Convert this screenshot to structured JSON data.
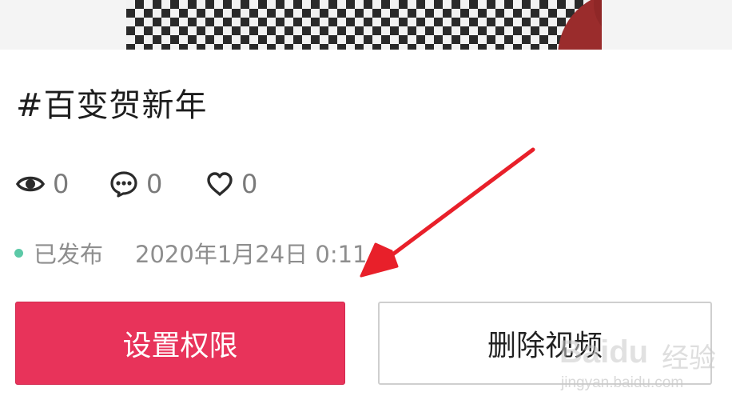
{
  "video": {
    "title": "#百变贺新年"
  },
  "stats": {
    "views": "0",
    "comments": "0",
    "likes": "0"
  },
  "status": {
    "label": "已发布",
    "published_time": "2020年1月24日 0:11",
    "dot_color": "#5cc9a7"
  },
  "actions": {
    "set_permission_label": "设置权限",
    "delete_video_label": "删除视频"
  },
  "colors": {
    "primary": "#e8335a",
    "annotation_arrow": "#e8202a"
  },
  "icons": {
    "views": "eye-icon",
    "comments": "comment-icon",
    "likes": "heart-icon"
  },
  "watermark": {
    "brand": "Baidu",
    "label": "经验",
    "url": "jingyan.baidu.com"
  }
}
